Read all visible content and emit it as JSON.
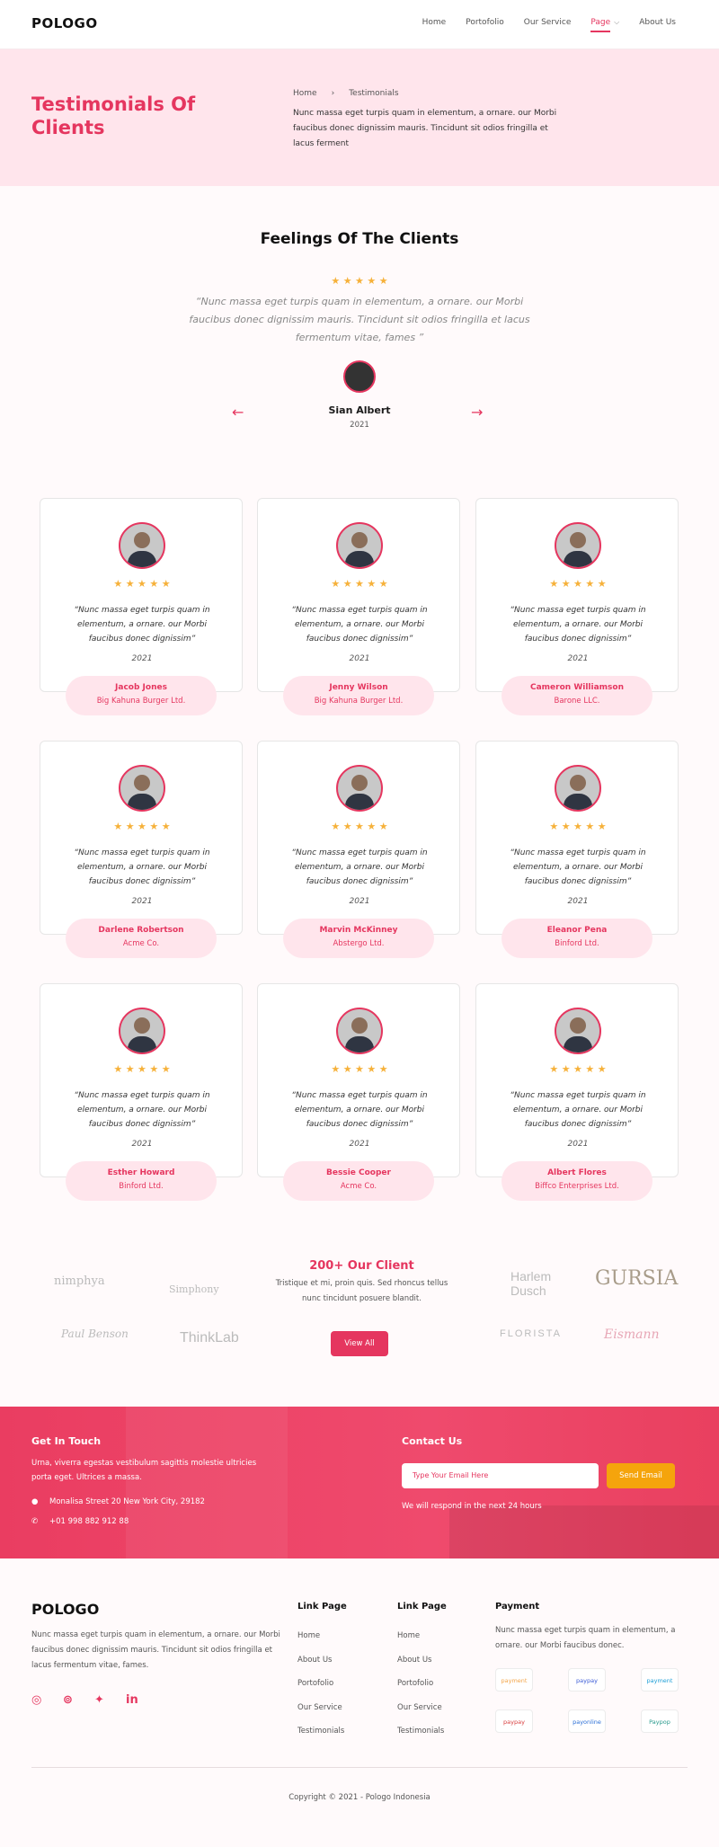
{
  "header": {
    "logo": "POLOGO",
    "nav": [
      "Home",
      "Portofolio",
      "Our Service",
      "Page",
      "About Us"
    ]
  },
  "hero": {
    "title": "Testimonials Of Clients",
    "breadcrumb": [
      "Home",
      "Testimonials"
    ],
    "text": "Nunc massa eget turpis quam in elementum, a ornare. our Morbi faucibus donec dignissim mauris. Tincidunt sit odios fringilla et lacus ferment"
  },
  "featured": {
    "title": "Feelings Of The Clients",
    "stars": "★ ★ ★ ★ ★",
    "quote": "“Nunc massa eget turpis quam in elementum, a ornare. our Morbi faucibus donec dignissim mauris. Tincidunt sit odios fringilla et lacus fermentum vitae, fames ”",
    "name": "Sian Albert",
    "year": "2021",
    "prev": "←",
    "next": "→"
  },
  "cards": [
    {
      "name": "Jacob Jones",
      "company": "Big Kahuna Burger Ltd.",
      "quote": "“Nunc massa eget turpis quam in elementum, a ornare. our Morbi faucibus donec dignissim”",
      "year": "2021"
    },
    {
      "name": "Jenny Wilson",
      "company": "Big Kahuna Burger Ltd.",
      "quote": "“Nunc massa eget turpis quam in elementum, a ornare. our Morbi faucibus donec dignissim”",
      "year": "2021"
    },
    {
      "name": "Cameron Williamson",
      "company": "Barone LLC.",
      "quote": "“Nunc massa eget turpis quam in elementum, a ornare. our Morbi faucibus donec dignissim”",
      "year": "2021"
    },
    {
      "name": "Darlene Robertson",
      "company": "Acme Co.",
      "quote": "“Nunc massa eget turpis quam in elementum, a ornare. our Morbi faucibus donec dignissim”",
      "year": "2021"
    },
    {
      "name": "Marvin McKinney",
      "company": "Abstergo Ltd.",
      "quote": "“Nunc massa eget turpis quam in elementum, a ornare. our Morbi faucibus donec dignissim”",
      "year": "2021"
    },
    {
      "name": "Eleanor Pena",
      "company": "Binford Ltd.",
      "quote": "“Nunc massa eget turpis quam in elementum, a ornare. our Morbi faucibus donec dignissim”",
      "year": "2021"
    },
    {
      "name": "Esther Howard",
      "company": "Binford Ltd.",
      "quote": "“Nunc massa eget turpis quam in elementum, a ornare. our Morbi faucibus donec dignissim”",
      "year": "2021"
    },
    {
      "name": "Bessie Cooper",
      "company": "Acme Co.",
      "quote": "“Nunc massa eget turpis quam in elementum, a ornare. our Morbi faucibus donec dignissim”",
      "year": "2021"
    },
    {
      "name": "Albert Flores",
      "company": "Biffco Enterprises Ltd.",
      "quote": "“Nunc massa eget turpis quam in elementum, a ornare. our Morbi faucibus donec dignissim”",
      "year": "2021"
    }
  ],
  "clients": {
    "title": "200+ Our Client",
    "text": "Tristique et mi, proin quis. Sed rhoncus tellus nunc tincidunt posuere blandit.",
    "button": "View All",
    "brands": [
      "nimphya",
      "Simphony",
      "Paul Benson",
      "ThinkLab",
      "Harlem Dusch",
      "GURSIA",
      "FLORISTA",
      "Eismann"
    ]
  },
  "contact": {
    "left_title": "Get In Touch",
    "left_text": "Urna, viverra egestas vestibulum sagittis molestie ultricies porta eget. Ultrices a massa.",
    "address": "Monalisa Street 20 New York City, 29182",
    "phone": "+01 998 882 912 88",
    "right_title": "Contact Us",
    "email_placeholder": "Type Your Email Here",
    "send": "Send Email",
    "note": "We will respond in the next 24 hours"
  },
  "footer": {
    "logo": "POLOGO",
    "text": "Nunc massa eget turpis quam in elementum, a ornare. our Morbi faucibus donec dignissim mauris. Tincidunt sit odios fringilla et lacus fermentum vitae, fames.",
    "col1_title": "Link Page",
    "col2_title": "Link Page",
    "links": [
      "Home",
      "About Us",
      "Portofolio",
      "Our Service",
      "Testimonials"
    ],
    "pay_title": "Payment",
    "pay_text": "Nunc massa eget turpis quam in elementum, a ornare. our Morbi faucibus donec.",
    "pay": [
      "payment",
      "paypay",
      "payment",
      "paypay",
      "payonline",
      "Paypop"
    ],
    "copyright": "Copyright © 2021 - Pologo Indonesia",
    "social": [
      "instagram",
      "messenger",
      "twitter",
      "linkedin"
    ]
  }
}
